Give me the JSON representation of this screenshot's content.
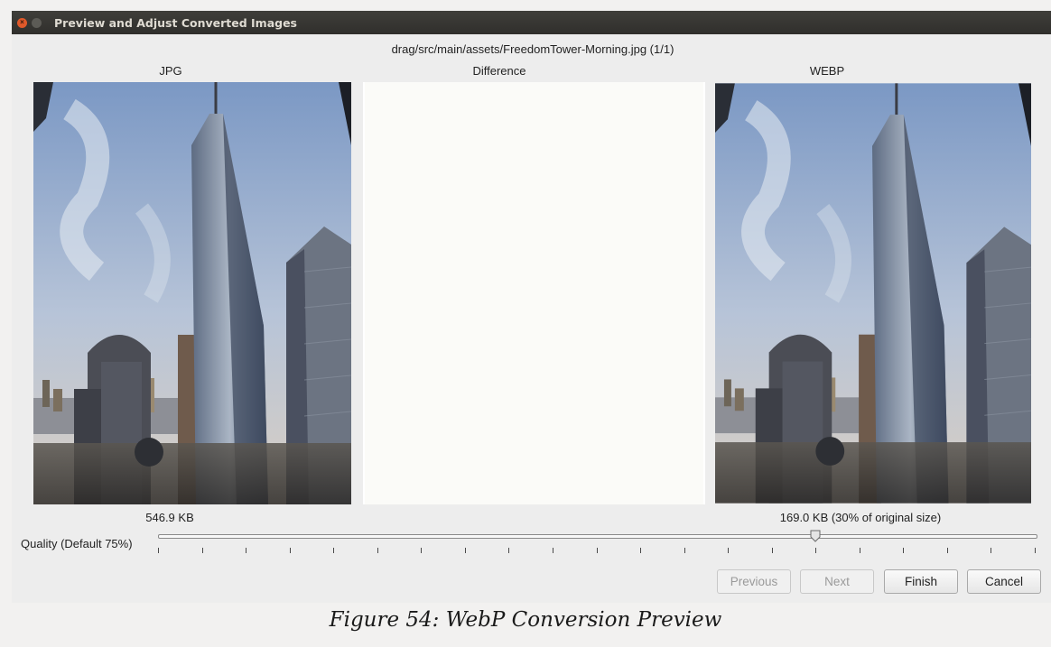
{
  "window": {
    "title": "Preview and Adjust Converted Images",
    "file_path": "drag/src/main/assets/FreedomTower-Morning.jpg (1/1)"
  },
  "columns": {
    "left_label": "JPG",
    "middle_label": "Difference",
    "right_label": "WEBP"
  },
  "sizes": {
    "original": "546.9 KB",
    "converted": "169.0 KB (30% of original size)"
  },
  "quality": {
    "label": "Quality (Default 75%)",
    "value_percent": 75,
    "tick_count": 21
  },
  "buttons": {
    "previous": "Previous",
    "next": "Next",
    "finish": "Finish",
    "cancel": "Cancel"
  },
  "caption": "Figure 54: WebP Conversion Preview"
}
